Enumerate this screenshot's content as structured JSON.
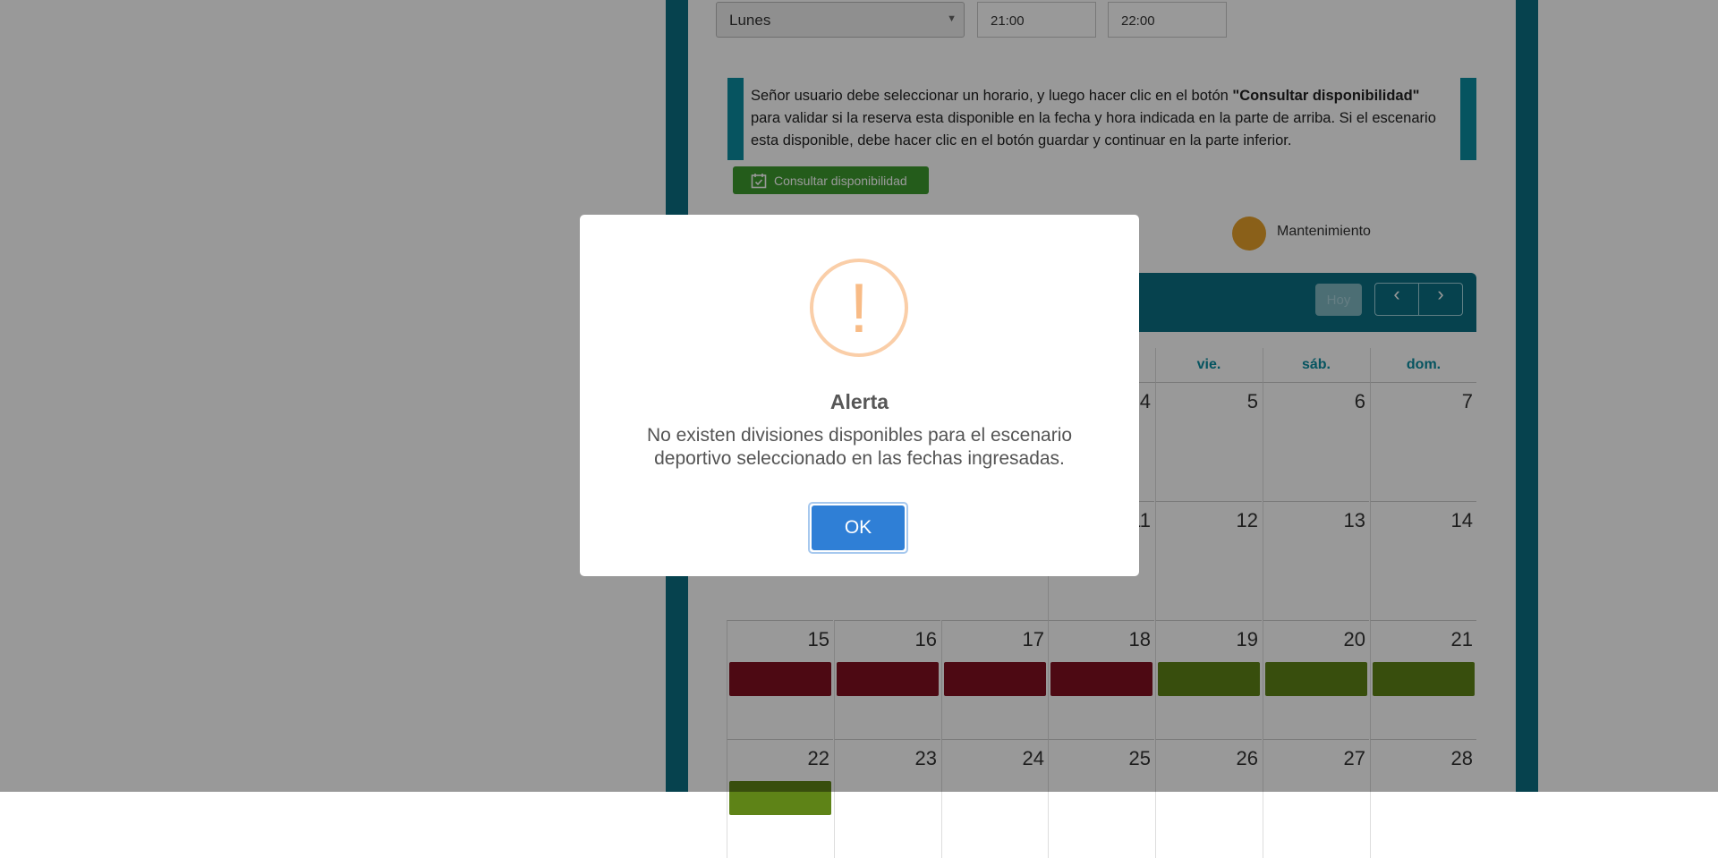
{
  "form": {
    "day_select": "Lunes",
    "start_time": "21:00",
    "end_time": "22:00"
  },
  "info": {
    "text_before": "Señor usuario debe seleccionar un horario, y luego hacer clic en el botón ",
    "bold_text": "\"Consultar disponibilidad\"",
    "text_after": " para validar si la reserva esta disponible en la fecha y hora indicada en la parte de arriba. Si el escenario esta disponible, debe hacer clic en el botón guardar y continuar en la parte inferior."
  },
  "check_button_label": "Consultar disponibilidad",
  "legend": {
    "maintenance_label": "Mantenimiento",
    "maintenance_color": "#e6a02a"
  },
  "calendar": {
    "today_label": "Hoy",
    "prev_label": "‹",
    "next_label": "›",
    "day_names": [
      "vie.",
      "sáb.",
      "dom."
    ],
    "rows": [
      {
        "days": [
          "4",
          "5",
          "6",
          "7"
        ]
      },
      {
        "days": [
          "11",
          "12",
          "13",
          "14"
        ]
      },
      {
        "days": [
          "15",
          "16",
          "17",
          "18",
          "19",
          "20",
          "21"
        ]
      },
      {
        "days": [
          "22",
          "23",
          "24",
          "25",
          "26",
          "27",
          "28"
        ]
      }
    ],
    "event_colors": {
      "booked": "#800f20",
      "available": "#5e8317"
    }
  },
  "modal": {
    "icon_symbol": "!",
    "title": "Alerta",
    "message": "No existen divisiones disponibles para el escenario deportivo seleccionado en las fechas ingresadas.",
    "ok_label": "OK"
  }
}
